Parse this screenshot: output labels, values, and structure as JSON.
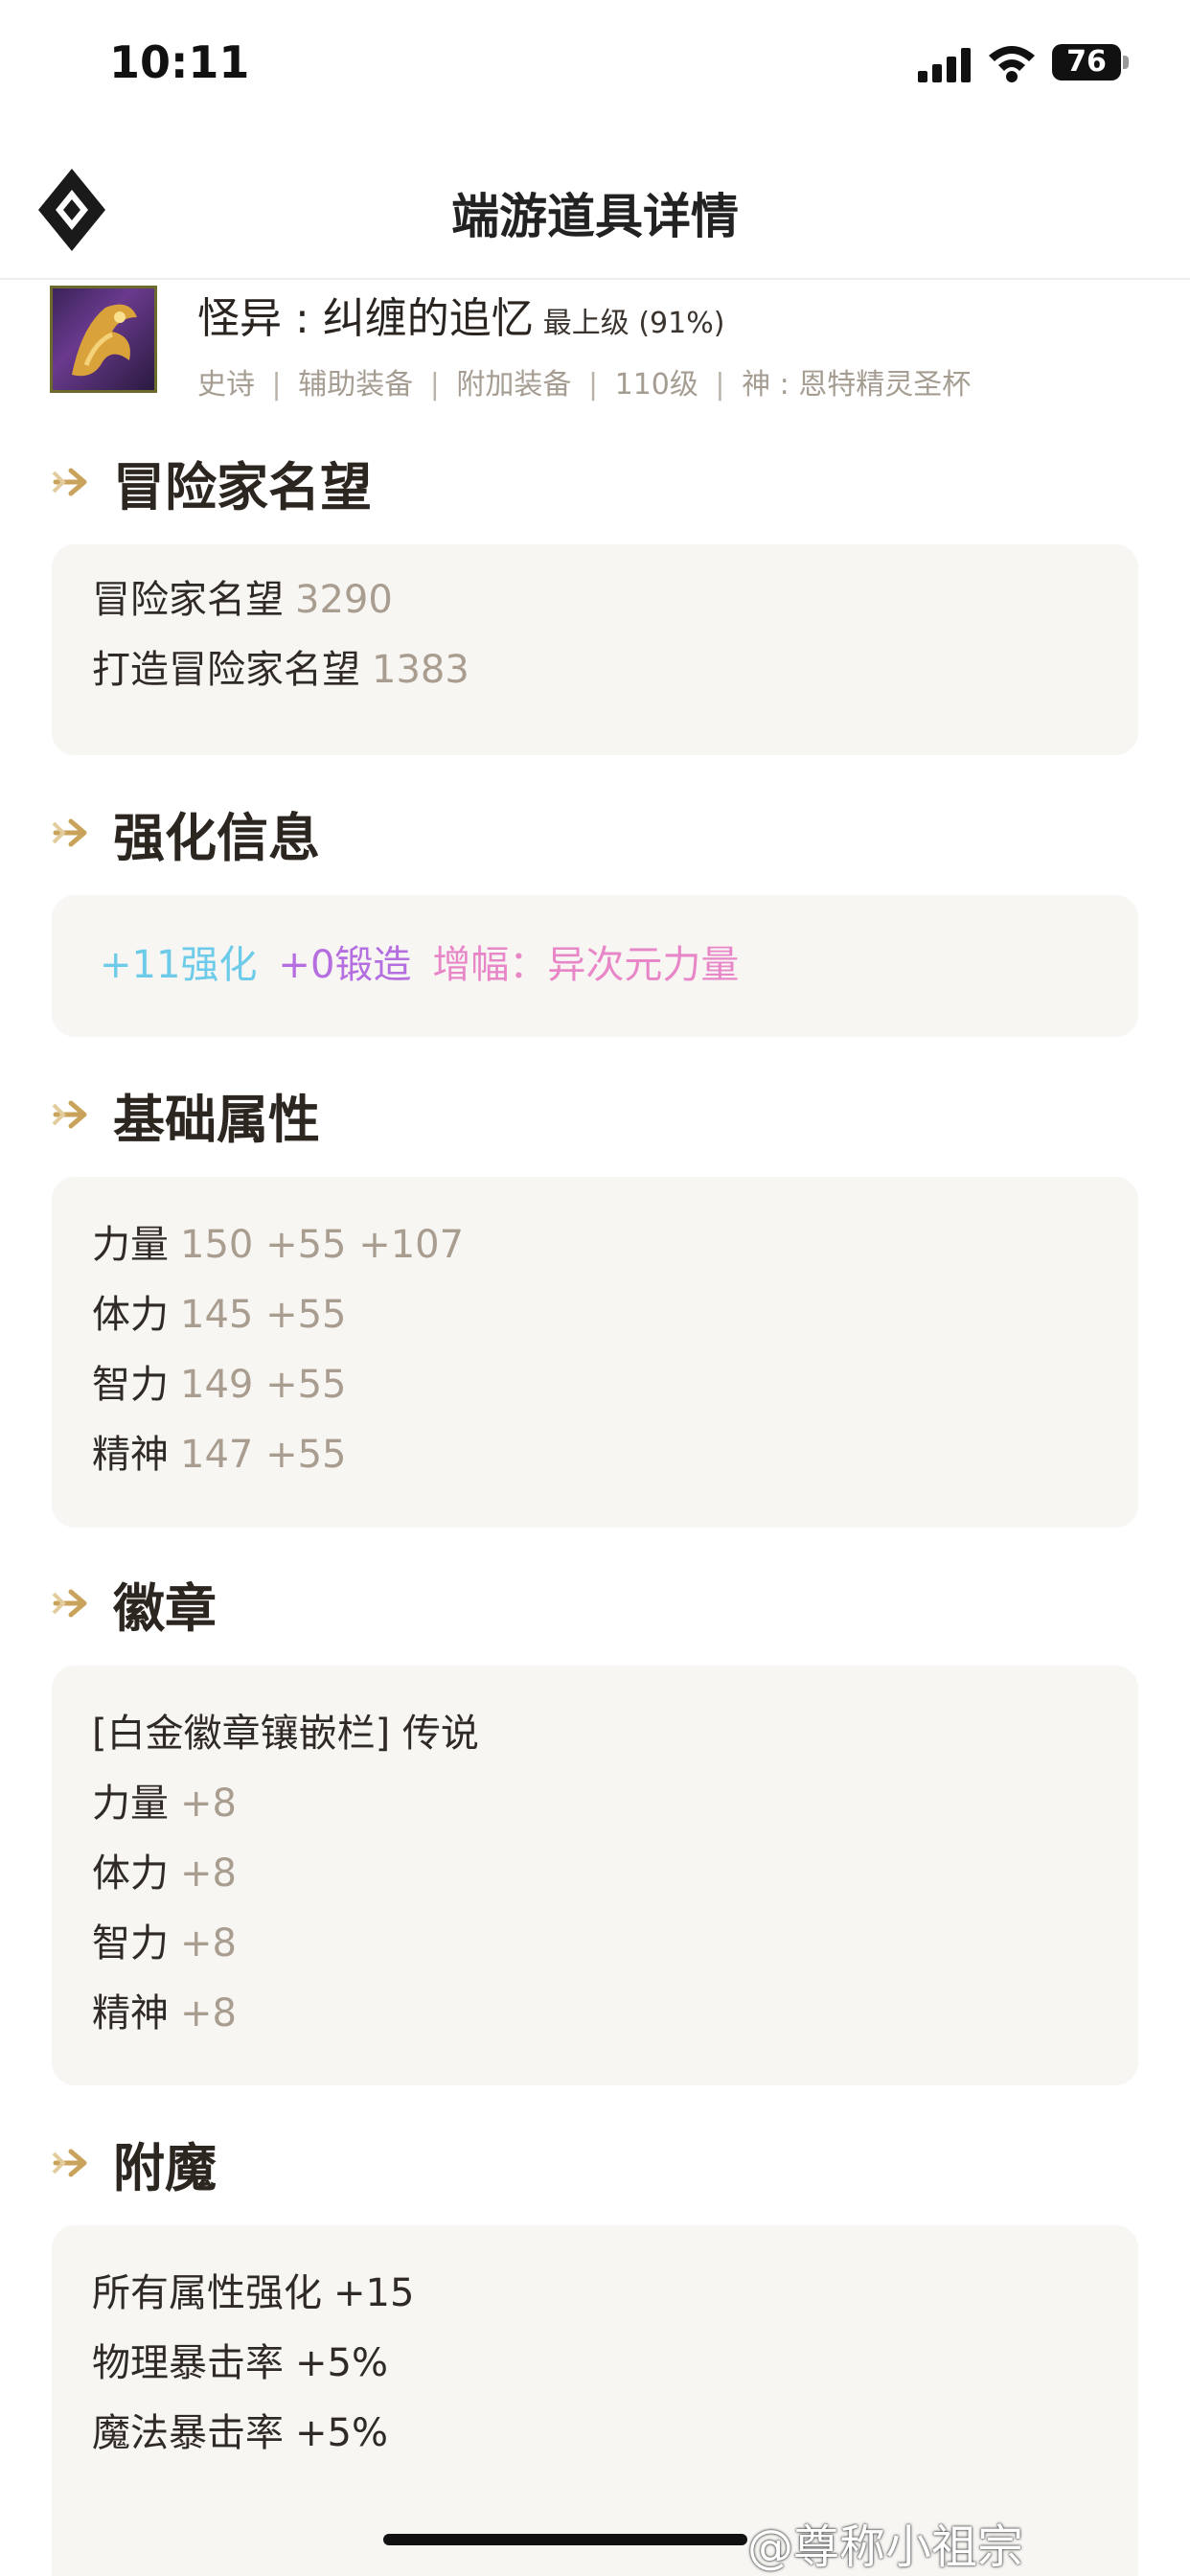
{
  "status": {
    "time": "10:11",
    "battery": "76"
  },
  "nav": {
    "title": "端游道具详情"
  },
  "item": {
    "name": "怪异 : 纠缠的追忆",
    "grade": "最上级 (91%)",
    "meta": [
      "史诗",
      "辅助装备",
      "附加装备",
      "110级",
      "神 : 恩特精灵圣杯"
    ]
  },
  "sections": {
    "reputation": {
      "title": "冒险家名望",
      "rows": [
        {
          "label": "冒险家名望",
          "value": "3290"
        },
        {
          "label": "打造冒险家名望",
          "value": "1383"
        }
      ]
    },
    "enhance": {
      "title": "强化信息",
      "reinforce": "+11强化",
      "forge": "+0锻造",
      "amplify": "增幅：异次元力量"
    },
    "base_stats": {
      "title": "基础属性",
      "rows": [
        {
          "label": "力量",
          "value": "150 +55 +107"
        },
        {
          "label": "体力",
          "value": "145 +55"
        },
        {
          "label": "智力",
          "value": "149 +55"
        },
        {
          "label": "精神",
          "value": "147 +55"
        }
      ]
    },
    "emblem": {
      "title": "徽章",
      "header": "[白金徽章镶嵌栏] 传说",
      "rows": [
        {
          "label": "力量",
          "value": "+8"
        },
        {
          "label": "体力",
          "value": "+8"
        },
        {
          "label": "智力",
          "value": "+8"
        },
        {
          "label": "精神",
          "value": "+8"
        }
      ]
    },
    "enchant": {
      "title": "附魔",
      "rows": [
        {
          "label": "所有属性强化",
          "value": "+15"
        },
        {
          "label": "物理暴击率",
          "value": "+5%"
        },
        {
          "label": "魔法暴击率",
          "value": "+5%"
        }
      ]
    }
  },
  "watermark": "@尊称小祖宗",
  "colors": {
    "accent": "#c9a35b",
    "value_gray": "#a89d8f",
    "card_bg": "#f8f6f3"
  }
}
